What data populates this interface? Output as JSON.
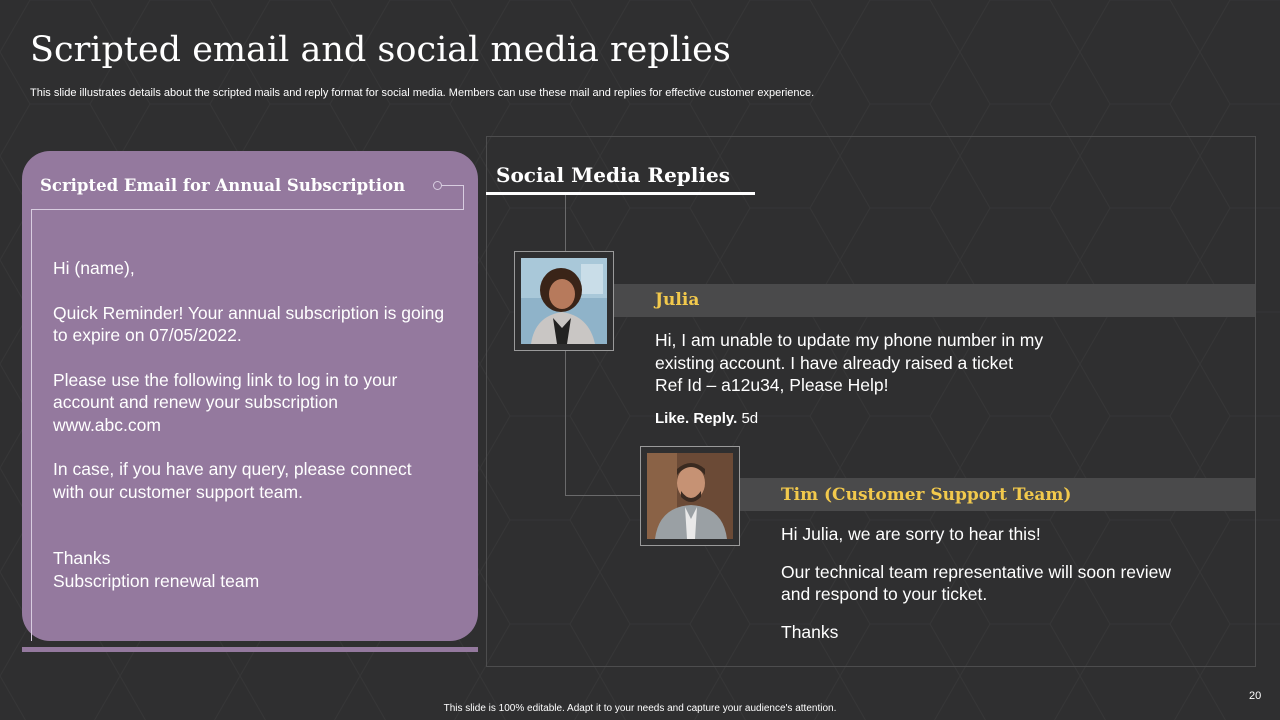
{
  "slide": {
    "title": "Scripted email and social media replies",
    "subtitle": "This slide illustrates details about the scripted mails and reply format for social media. Members can use these mail and replies for effective customer experience.",
    "footer": "This slide is 100% editable.  Adapt it to your needs and capture your audience's attention.",
    "page_number": "20"
  },
  "email": {
    "heading": "Scripted Email for Annual Subscription",
    "greeting": "Hi (name),",
    "reminder": "Quick Reminder! Your annual subscription is going\nto expire on 07/05/2022.",
    "instruction": "Please use the following link to log in to your\naccount and renew your subscription\nwww.abc.com",
    "query": "In case, if you have any query, please connect\nwith our customer support team.",
    "signoff": "Thanks\nSubscription renewal team"
  },
  "social": {
    "heading": "Social Media Replies",
    "comment": {
      "author": "Julia",
      "text": "Hi, I am unable to update my phone number in my\nexisting account. I have already raised a ticket\nRef Id – a12u34, Please Help!",
      "like_label": "Like.",
      "reply_label": "Reply.",
      "age": "5d"
    },
    "reply": {
      "author": "Tim (Customer Support Team)",
      "line1": "Hi Julia, we are sorry to hear this!",
      "line2": "Our technical team representative will soon review\nand respond to your ticket.",
      "line3": "Thanks"
    }
  },
  "colors": {
    "background": "#2f2f30",
    "email_card": "#94799e",
    "name_highlight": "#f2c94c",
    "name_bar": "#4a4a4b"
  },
  "icons": [
    "julia-avatar-icon",
    "tim-avatar-icon"
  ]
}
